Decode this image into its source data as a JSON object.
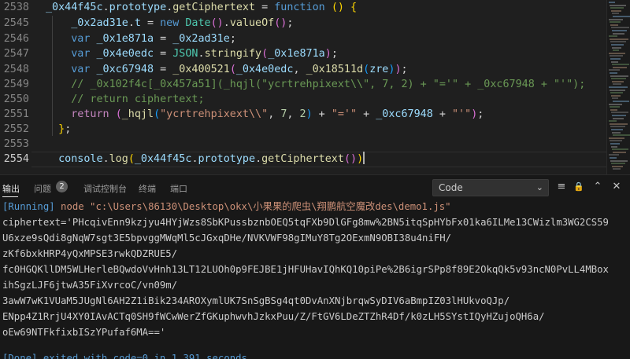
{
  "editor": {
    "lines": [
      {
        "num": "2538",
        "segments": [
          [
            "_0x44f45c",
            "id"
          ],
          [
            ".",
            "pl"
          ],
          [
            "prototype",
            "id"
          ],
          [
            ".",
            "pl"
          ],
          [
            "getCiphertext",
            "fn"
          ],
          [
            " = ",
            "pl"
          ],
          [
            "function",
            "kw"
          ],
          [
            " ",
            "pl"
          ],
          [
            "()",
            "b1"
          ],
          [
            " ",
            "pl"
          ],
          [
            "{",
            "b1"
          ]
        ]
      },
      {
        "num": "2545",
        "segments": [
          [
            "    ",
            "pl"
          ],
          [
            "_0x2ad31e",
            "id"
          ],
          [
            ".",
            "pl"
          ],
          [
            "t",
            "id"
          ],
          [
            " = ",
            "pl"
          ],
          [
            "new",
            "kw"
          ],
          [
            " ",
            "pl"
          ],
          [
            "Date",
            "obj"
          ],
          [
            "()",
            "b2"
          ],
          [
            ".",
            "pl"
          ],
          [
            "valueOf",
            "fn"
          ],
          [
            "()",
            "b2"
          ],
          [
            ";",
            "pl"
          ]
        ]
      },
      {
        "num": "2546",
        "segments": [
          [
            "    ",
            "pl"
          ],
          [
            "var",
            "kw"
          ],
          [
            " ",
            "pl"
          ],
          [
            "_0x1e871a",
            "id"
          ],
          [
            " = ",
            "pl"
          ],
          [
            "_0x2ad31e",
            "id"
          ],
          [
            ";",
            "pl"
          ]
        ]
      },
      {
        "num": "2547",
        "segments": [
          [
            "    ",
            "pl"
          ],
          [
            "var",
            "kw"
          ],
          [
            " ",
            "pl"
          ],
          [
            "_0x4e0edc",
            "id"
          ],
          [
            " = ",
            "pl"
          ],
          [
            "JSON",
            "obj"
          ],
          [
            ".",
            "pl"
          ],
          [
            "stringify",
            "fn"
          ],
          [
            "(",
            "b2"
          ],
          [
            "_0x1e871a",
            "id"
          ],
          [
            ")",
            "b2"
          ],
          [
            ";",
            "pl"
          ]
        ]
      },
      {
        "num": "2548",
        "segments": [
          [
            "    ",
            "pl"
          ],
          [
            "var",
            "kw"
          ],
          [
            " ",
            "pl"
          ],
          [
            "_0xc67948",
            "id"
          ],
          [
            " = ",
            "pl"
          ],
          [
            "_0x400521",
            "fn"
          ],
          [
            "(",
            "b2"
          ],
          [
            "_0x4e0edc",
            "id"
          ],
          [
            ", ",
            "pl"
          ],
          [
            "_0x18511d",
            "fn"
          ],
          [
            "(",
            "b3"
          ],
          [
            "zre",
            "id"
          ],
          [
            ")",
            "b3"
          ],
          [
            ")",
            "b2"
          ],
          [
            ";",
            "pl"
          ]
        ]
      },
      {
        "num": "2549",
        "segments": [
          [
            "    ",
            "pl"
          ],
          [
            "// _0x102f4c[_0x457a51](_hqjl(\"ycrtrehpixext\\\\\", 7, 2) + \"='\" + _0xc67948 + \"'\");",
            "cmt"
          ]
        ]
      },
      {
        "num": "2550",
        "segments": [
          [
            "    ",
            "pl"
          ],
          [
            "// return ciphertext;",
            "cmt"
          ]
        ]
      },
      {
        "num": "2551",
        "segments": [
          [
            "    ",
            "pl"
          ],
          [
            "return",
            "ctl"
          ],
          [
            " ",
            "pl"
          ],
          [
            "(",
            "b2"
          ],
          [
            "_hqjl",
            "fn"
          ],
          [
            "(",
            "b3"
          ],
          [
            "\"ycrtrehpixext\\\\\"",
            "str"
          ],
          [
            ", ",
            "pl"
          ],
          [
            "7",
            "num"
          ],
          [
            ", ",
            "pl"
          ],
          [
            "2",
            "num"
          ],
          [
            ")",
            "b3"
          ],
          [
            " + ",
            "pl"
          ],
          [
            "\"='\"",
            "str"
          ],
          [
            " + ",
            "pl"
          ],
          [
            "_0xc67948",
            "id"
          ],
          [
            " + ",
            "pl"
          ],
          [
            "\"'\"",
            "str"
          ],
          [
            ")",
            "b2"
          ],
          [
            ";",
            "pl"
          ]
        ]
      },
      {
        "num": "2552",
        "segments": [
          [
            "  ",
            "pl"
          ],
          [
            "}",
            "b1"
          ],
          [
            ";",
            "pl"
          ]
        ]
      },
      {
        "num": "2553",
        "segments": []
      },
      {
        "num": "2554",
        "segments": [
          [
            "  ",
            "pl"
          ],
          [
            "console",
            "id"
          ],
          [
            ".",
            "pl"
          ],
          [
            "log",
            "fn"
          ],
          [
            "(",
            "b1"
          ],
          [
            "_0x44f45c",
            "id"
          ],
          [
            ".",
            "pl"
          ],
          [
            "prototype",
            "id"
          ],
          [
            ".",
            "pl"
          ],
          [
            "getCiphertext",
            "fn"
          ],
          [
            "()",
            "b2"
          ],
          [
            ")",
            "b1"
          ]
        ]
      }
    ]
  },
  "panel": {
    "tabs": {
      "output": "输出",
      "problems": "问题",
      "problems_count": "2",
      "debug_console": "调试控制台",
      "terminal": "终端",
      "ports": "端口"
    },
    "channel": "Code",
    "channel_chevron": "⌄",
    "icons": {
      "clear": "≡",
      "lock": "🔒",
      "collapse": "⌃",
      "close": "✕"
    },
    "output_lines": {
      "running_tag": "[Running]",
      "running_cmd": " node \"c:\\Users\\86130\\Desktop\\okx\\小果果的爬虫\\翔鹏航空魔改des\\demo1.js\"",
      "l1": "ciphertext='PHcqivEnn9kzjyu4HYjWzs8SbKPussbznbOEQ5tqFXb9DlGFg8mw%2BN5itqSpHYbFx01ka6ILMe13CWizlm3WG2CS59",
      "l2": "U6xze9sQdi8gNqW7sgt3E5bpvggMWqMl5cJGxqDHe/NVKVWF98gIMuY8Tg2OExmN9OBI38u4niFH/",
      "l3": "zKf6bxkHRP4yQxMPSE3rwkQDZRUE5/",
      "l4": "fc0HGQKllDM5WLHerleBQwdoVvHnh13LT12LUOh0p9FEJBE1jHFUHavIQhKQ10piPe%2B6igrSPp8f89E2OkqQk5v93ncN0PvLL4MBox",
      "l5": "ihSgzLJF6jtwA35FiXvrcoC/vn09m/",
      "l6": "3awW7wK1VUaM5JUgNl6AH2Z1iBik234AROXymlUK7SnSgBSg4qt0DvAnXNjbrqwSyDIV6aBmpIZ03lHUkvoQJp/",
      "l7": "ENpp4Z1RrjU4XY0IAvACTq0SH9fWCwWerZfGKuphwvhJzkxPuu/Z/FtGV6LDeZTZhR4Df/k0zLH5SYstIQyHZujoQH6a/",
      "l8": "oEw69NTFkfixbISzYPufaf6MA=='",
      "done_tag": "[Done]",
      "done_msg": " exited with code=0 in 1.391 seconds"
    }
  }
}
